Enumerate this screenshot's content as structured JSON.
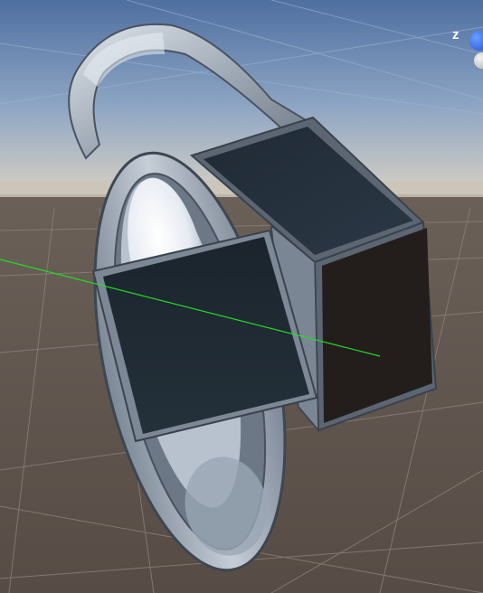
{
  "editor": {
    "view": "scene",
    "gizmo": {
      "axis_label": "z",
      "colors": {
        "z": "#2f6bff",
        "center": "#d8d8d8"
      }
    },
    "colors": {
      "sky_top": "#4f6fa1",
      "horizon": "#c9c2b5",
      "ground": "#5a4f47",
      "grid_line": "#8a8078",
      "selection_axis": "#22dd22",
      "metal": "#a9b3bf",
      "panel_dark": "#1e2731",
      "panel_side": "#231e1c"
    }
  }
}
